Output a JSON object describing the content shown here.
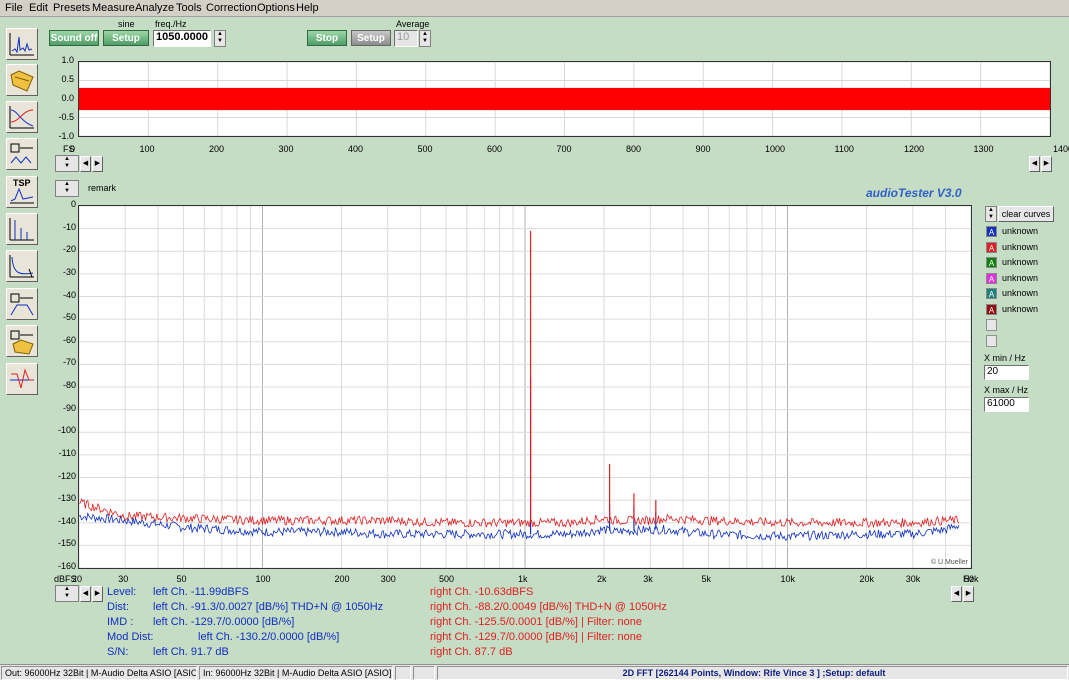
{
  "menu": [
    "File",
    "Edit",
    "Presets",
    "Measure",
    "Analyze",
    "Tools",
    "Correction",
    "Options",
    "Help"
  ],
  "toolbar_icons": [
    "fft-spectrum-icon",
    "folder-open-icon",
    "frequency-response-icon",
    "distortion-test-icon",
    "tsp-icon",
    "impulse-response-icon",
    "waterfall-icon",
    "speaker-measure-icon",
    "folder-preset-icon",
    "filter-curve-icon"
  ],
  "tsp_label": "TSP",
  "generator": {
    "sound_off_label": "Sound off",
    "waveform_label": "sine",
    "setup_label": "Setup",
    "freq_label": "freq./Hz",
    "freq_value": "1050.0000",
    "stop_label": "Stop",
    "setup2_label": "Setup",
    "average_label": "Average",
    "average_value": "10"
  },
  "scope": {
    "y_ticks": [
      "1.0",
      "0.5",
      "0.0",
      "-0.5",
      "-1.0"
    ],
    "x_ticks": [
      "0",
      "100",
      "200",
      "300",
      "400",
      "500",
      "600",
      "700",
      "800",
      "900",
      "1000",
      "1100",
      "1200",
      "1300",
      "1400ms"
    ],
    "fs_label": "FS",
    "signal_color": "#ff0000"
  },
  "fft": {
    "remark_label": "remark",
    "brand": "audioTester  V3.0",
    "watermark": "© U.Mueller",
    "y_ticks": [
      "0",
      "-10",
      "-20",
      "-30",
      "-40",
      "-50",
      "-60",
      "-70",
      "-80",
      "-90",
      "-100",
      "-110",
      "-120",
      "-130",
      "-140",
      "-150",
      "-160"
    ],
    "y_unit": "dBFS",
    "x_ticks": [
      "20",
      "30",
      "50",
      "100",
      "200",
      "300",
      "500",
      "1k",
      "2k",
      "3k",
      "5k",
      "10k",
      "20k",
      "30k",
      "50k"
    ],
    "x_unit": "Hz",
    "clear_curves_label": "clear curves",
    "legend": [
      {
        "letter": "A",
        "color": "#1030c0",
        "label": "unknown"
      },
      {
        "letter": "A",
        "color": "#e02020",
        "label": "unknown"
      },
      {
        "letter": "A",
        "color": "#108010",
        "label": "unknown"
      },
      {
        "letter": "A",
        "color": "#e030e0",
        "label": "unknown"
      },
      {
        "letter": "A",
        "color": "#208080",
        "label": "unknown"
      },
      {
        "letter": "A",
        "color": "#901010",
        "label": "unknown"
      }
    ],
    "xmin_label": "X min / Hz",
    "xmin_value": "20",
    "xmax_label": "X max / Hz",
    "xmax_value": "61000"
  },
  "chart_data": {
    "type": "line",
    "xscale": "log",
    "xlim": [
      20,
      61000
    ],
    "ylim": [
      -160,
      0
    ],
    "ylabel": "dBFS",
    "xlabel": "Hz",
    "series": [
      {
        "color": "#e02020",
        "x": [
          20,
          30,
          50,
          100,
          200,
          300,
          500,
          800,
          1000,
          1050,
          1100,
          1500,
          2000,
          2100,
          2200,
          2600,
          3000,
          3150,
          3500,
          5000,
          10000,
          20000,
          30000,
          40000,
          45000
        ],
        "y": [
          -131,
          -137,
          -138,
          -139,
          -139,
          -139,
          -140,
          -140,
          -140,
          -11,
          -140,
          -140,
          -138,
          -114,
          -139,
          -127,
          -139,
          -130,
          -138,
          -139,
          -140,
          -140,
          -140,
          -139,
          -139
        ]
      },
      {
        "color": "#1030c0",
        "x": [
          20,
          30,
          50,
          100,
          200,
          300,
          500,
          800,
          1000,
          1050,
          1100,
          1500,
          2000,
          2100,
          2200,
          2600,
          3000,
          3150,
          3500,
          5000,
          10000,
          20000,
          30000,
          40000,
          45000
        ],
        "y": [
          -137,
          -139,
          -142,
          -144,
          -144,
          -145,
          -145,
          -145,
          -145,
          -76,
          -145,
          -145,
          -143,
          -132,
          -144,
          -133,
          -143,
          -135,
          -143,
          -145,
          -146,
          -145,
          -145,
          -143,
          -141
        ]
      }
    ]
  },
  "readout": {
    "rows": [
      {
        "label": "Level:",
        "left": "left Ch. -11.99dBFS",
        "right": "right Ch. -10.63dBFS"
      },
      {
        "label": "Dist:",
        "left": "left Ch. -91.3/0.0027 [dB/%] THD+N  @ 1050Hz",
        "right": "right Ch. -88.2/0.0049 [dB/%] THD+N  @ 1050Hz"
      },
      {
        "label": "IMD  :",
        "left": "left Ch. -129.7/0.0000 [dB/%]",
        "right": "right Ch. -125.5/0.0001 [dB/%] |   Filter: none"
      },
      {
        "label": "Mod Dist:",
        "left": "left Ch. -130.2/0.0000 [dB/%]",
        "right": "right Ch. -129.7/0.0000 [dB/%] |   Filter: none"
      },
      {
        "label": "S/N:",
        "left": "left Ch. 91.7 dB",
        "right": "right Ch. 87.7 dB"
      }
    ],
    "left_color": "#1030c0",
    "right_color": "#e02020"
  },
  "status": {
    "out": "Out: 96000Hz 32Bit  | M-Audio Delta ASIO [ASIO]",
    "in": "In: 96000Hz 32Bit  | M-Audio Delta ASIO [ASIO]",
    "info": "2D FFT [262144 Points, Window: Rife Vince 3 ] ;Setup:  default"
  }
}
